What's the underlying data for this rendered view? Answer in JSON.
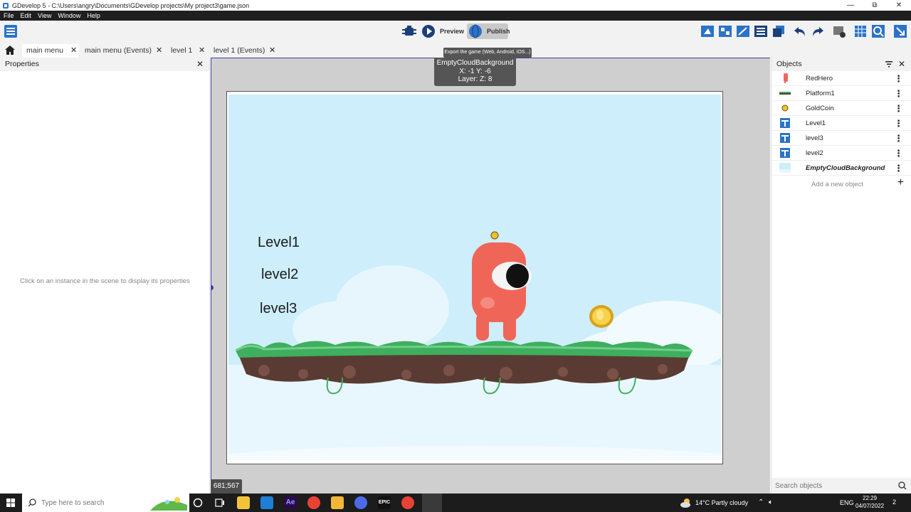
{
  "window": {
    "title": "GDevelop 5 - C:\\Users\\angry\\Documents\\GDevelop projects\\My project3\\game.json",
    "minimize": "—",
    "restore": "⧉",
    "close": "✕"
  },
  "menu": [
    "File",
    "Edit",
    "View",
    "Window",
    "Help"
  ],
  "toolbar": {
    "preview_label": "Preview",
    "publish_label": "Publish",
    "publish_tooltip": "Export the game (Web, Android, iOS...)"
  },
  "tabs": [
    {
      "label": "main menu",
      "close": "✕"
    },
    {
      "label": "main menu (Events)",
      "close": "✕"
    },
    {
      "label": "level 1",
      "close": "✕"
    },
    {
      "label": "level 1 (Events)",
      "close": "✕"
    }
  ],
  "properties": {
    "title": "Properties",
    "close": "✕",
    "hint": "Click on an instance in the scene to display its properties"
  },
  "scene": {
    "instance_tooltip": {
      "name": "EmptyCloudBackground",
      "position": "X: -1  Y: -6",
      "layer": "Layer:   Z: 8"
    },
    "level_texts": [
      "Level1",
      "level2",
      "level3"
    ],
    "cursor_coords": "681;567"
  },
  "objects": {
    "title": "Objects",
    "close": "✕",
    "items": [
      {
        "name": "RedHero",
        "icon": "red-hero-icon",
        "menu": "⋮"
      },
      {
        "name": "Platform1",
        "icon": "platform-icon",
        "menu": "⋮"
      },
      {
        "name": "GoldCoin",
        "icon": "gold-coin-icon",
        "menu": "⋮"
      },
      {
        "name": "Level1",
        "icon": "text-object-icon",
        "menu": "⋮"
      },
      {
        "name": "level3",
        "icon": "text-object-icon",
        "menu": "⋮"
      },
      {
        "name": "level2",
        "icon": "text-object-icon",
        "menu": "⋮"
      },
      {
        "name": "EmptyCloudBackground",
        "icon": "cloud-background-icon",
        "menu": "⋮"
      }
    ],
    "add_new": "Add a new object",
    "add_plus": "+",
    "search_placeholder": "Search objects"
  },
  "taskbar": {
    "search_placeholder": "Type here to search",
    "weather": "14°C  Partly cloudy",
    "language": "ENG",
    "time": "22:29",
    "date": "04/07/2022",
    "notifications": "2",
    "epic_label": "EPIC",
    "ae_label": "Ae"
  },
  "colors": {
    "menubar": "#1f1f1f",
    "sky": "#cdeefa",
    "hero": "#ef6658",
    "grass": "#3fae5e",
    "soil": "#5a3b33",
    "coin": "#f2c12e",
    "accent": "#3f3fa0"
  }
}
